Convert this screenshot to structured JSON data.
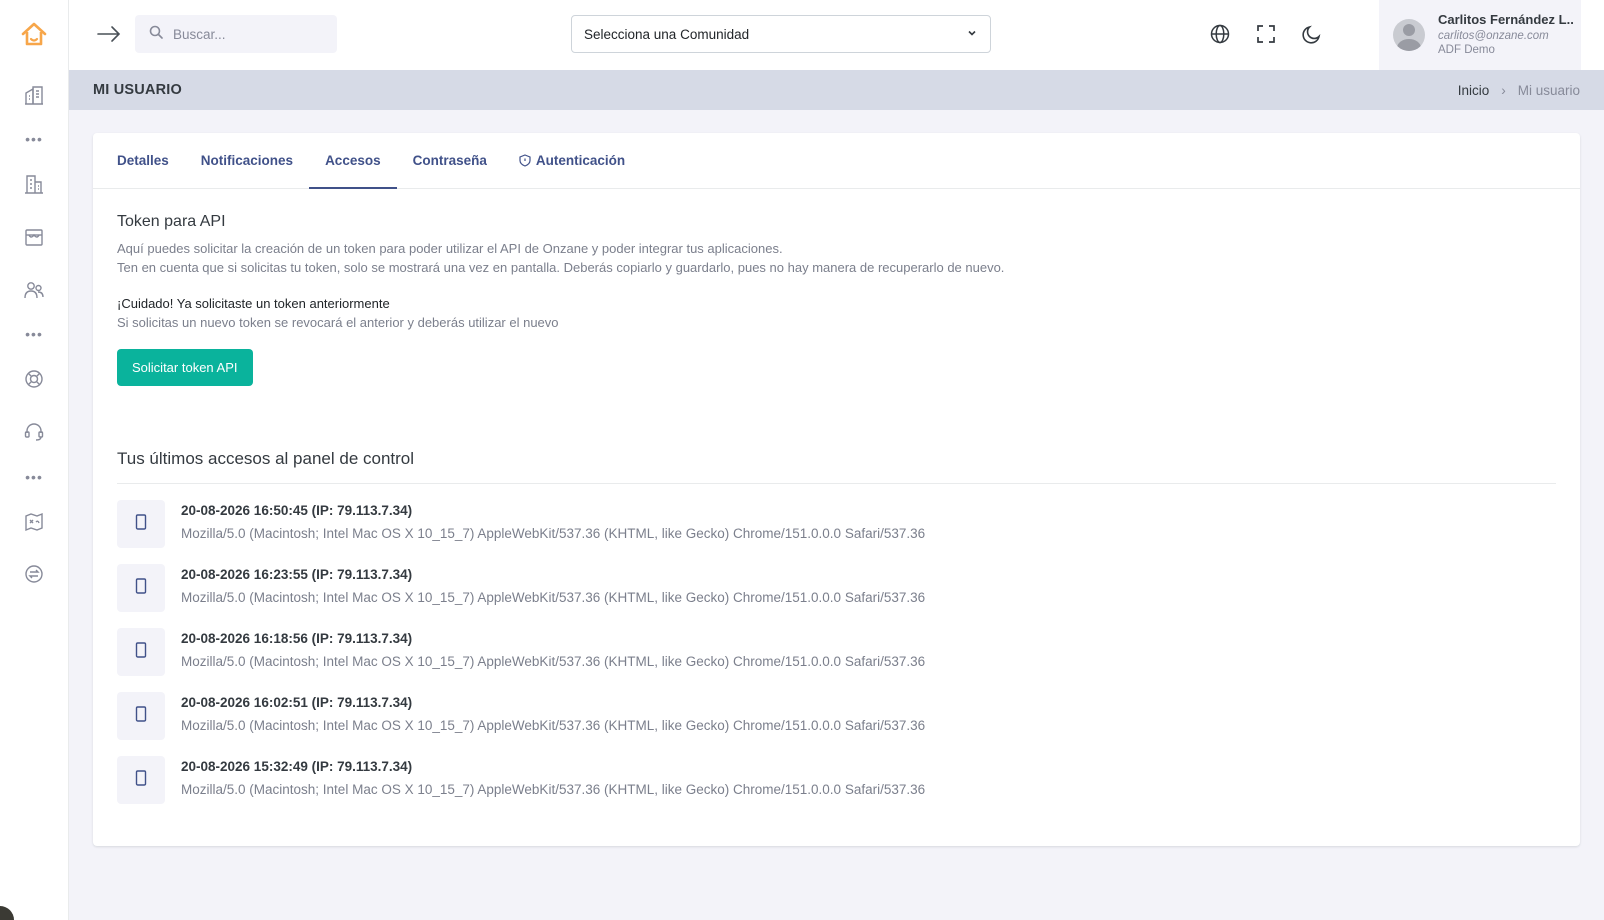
{
  "topbar": {
    "search_placeholder": "Buscar...",
    "community_select": "Selecciona una Comunidad",
    "user": {
      "name": "Carlitos Fernández L..",
      "email": "carlitos@onzane.com",
      "org": "ADF Demo"
    }
  },
  "header": {
    "title": "MI USUARIO",
    "breadcrumb": {
      "home": "Inicio",
      "separator": "›",
      "current": "Mi usuario"
    }
  },
  "tabs": [
    {
      "label": "Detalles"
    },
    {
      "label": "Notificaciones"
    },
    {
      "label": "Accesos"
    },
    {
      "label": "Contraseña"
    },
    {
      "label": "Autenticación"
    }
  ],
  "token": {
    "title": "Token para API",
    "desc1": "Aquí puedes solicitar la creación de un token para poder utilizar el API de Onzane y poder integrar tus aplicaciones.",
    "desc2": "Ten en cuenta que si solicitas tu token, solo se mostrará una vez en pantalla. Deberás copiarlo y guardarlo, pues no hay manera de recuperarlo de nuevo.",
    "warning_title": "¡Cuidado! Ya solicitaste un token anteriormente",
    "warning_desc": "Si solicitas un nuevo token se revocará el anterior y deberás utilizar el nuevo",
    "button": "Solicitar token API"
  },
  "accesses": {
    "title": "Tus últimos accesos al panel de control",
    "items": [
      {
        "date": "20-08-2026 16:50:45 (IP: 79.113.7.34)",
        "ua": "Mozilla/5.0 (Macintosh; Intel Mac OS X 10_15_7) AppleWebKit/537.36 (KHTML, like Gecko) Chrome/151.0.0.0 Safari/537.36"
      },
      {
        "date": "20-08-2026 16:23:55 (IP: 79.113.7.34)",
        "ua": "Mozilla/5.0 (Macintosh; Intel Mac OS X 10_15_7) AppleWebKit/537.36 (KHTML, like Gecko) Chrome/151.0.0.0 Safari/537.36"
      },
      {
        "date": "20-08-2026 16:18:56 (IP: 79.113.7.34)",
        "ua": "Mozilla/5.0 (Macintosh; Intel Mac OS X 10_15_7) AppleWebKit/537.36 (KHTML, like Gecko) Chrome/151.0.0.0 Safari/537.36"
      },
      {
        "date": "20-08-2026 16:02:51 (IP: 79.113.7.34)",
        "ua": "Mozilla/5.0 (Macintosh; Intel Mac OS X 10_15_7) AppleWebKit/537.36 (KHTML, like Gecko) Chrome/151.0.0.0 Safari/537.36"
      },
      {
        "date": "20-08-2026 15:32:49 (IP: 79.113.7.34)",
        "ua": "Mozilla/5.0 (Macintosh; Intel Mac OS X 10_15_7) AppleWebKit/537.36 (KHTML, like Gecko) Chrome/151.0.0.0 Safari/537.36"
      }
    ]
  },
  "colors": {
    "accent": "#405189",
    "success": "#0ab39c",
    "logo": "#f7a64a",
    "title_bar": "#d6dae6"
  }
}
